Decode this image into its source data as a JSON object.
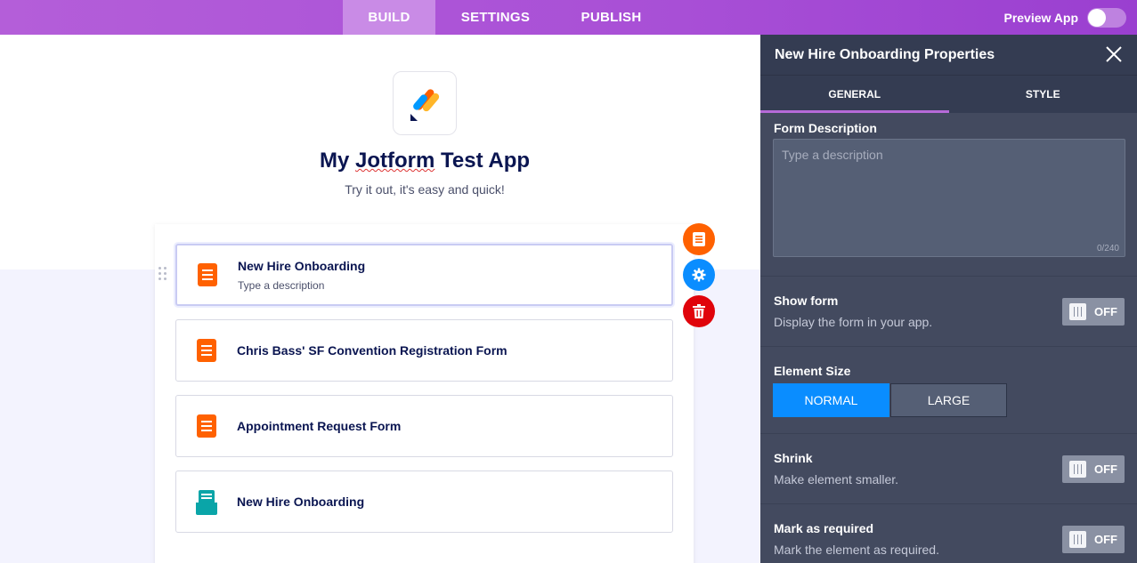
{
  "nav": {
    "tabs": [
      {
        "label": "BUILD"
      },
      {
        "label": "SETTINGS"
      },
      {
        "label": "PUBLISH"
      }
    ],
    "preview_label": "Preview App"
  },
  "app": {
    "title_part1": "My ",
    "title_part2": "Jotform",
    "title_part3": " Test App",
    "subtitle": "Try it out, it's easy and quick!"
  },
  "items": [
    {
      "name": "New Hire Onboarding",
      "description": "Type a description",
      "icon": "form-icon",
      "color": "#ff6100"
    },
    {
      "name": "Chris Bass' SF Convention Registration Form",
      "icon": "form-icon",
      "color": "#ff6100"
    },
    {
      "name": "Appointment Request Form",
      "icon": "form-icon",
      "color": "#ff6100"
    },
    {
      "name": "New Hire Onboarding",
      "icon": "inbox-form-icon",
      "color": "#0aa5a8"
    }
  ],
  "panel": {
    "title": "New Hire Onboarding Properties",
    "tabs": {
      "general": "GENERAL",
      "style": "STYLE"
    },
    "form_description": {
      "label": "Form Description",
      "placeholder": "Type a description",
      "counter": "0/240"
    },
    "show_form": {
      "label": "Show form",
      "description": "Display the form in your app.",
      "state": "OFF"
    },
    "element_size": {
      "label": "Element Size",
      "normal": "NORMAL",
      "large": "LARGE",
      "selected": "NORMAL"
    },
    "shrink": {
      "label": "Shrink",
      "description": "Make element smaller.",
      "state": "OFF"
    },
    "required": {
      "label": "Mark as required",
      "description": "Mark the element as required.",
      "state": "OFF"
    }
  },
  "colors": {
    "accent_purple": "#a84fd6",
    "primary_blue": "#0a8dff",
    "danger_red": "#e0040b",
    "orange": "#ff6100",
    "navy": "#0a1551"
  }
}
